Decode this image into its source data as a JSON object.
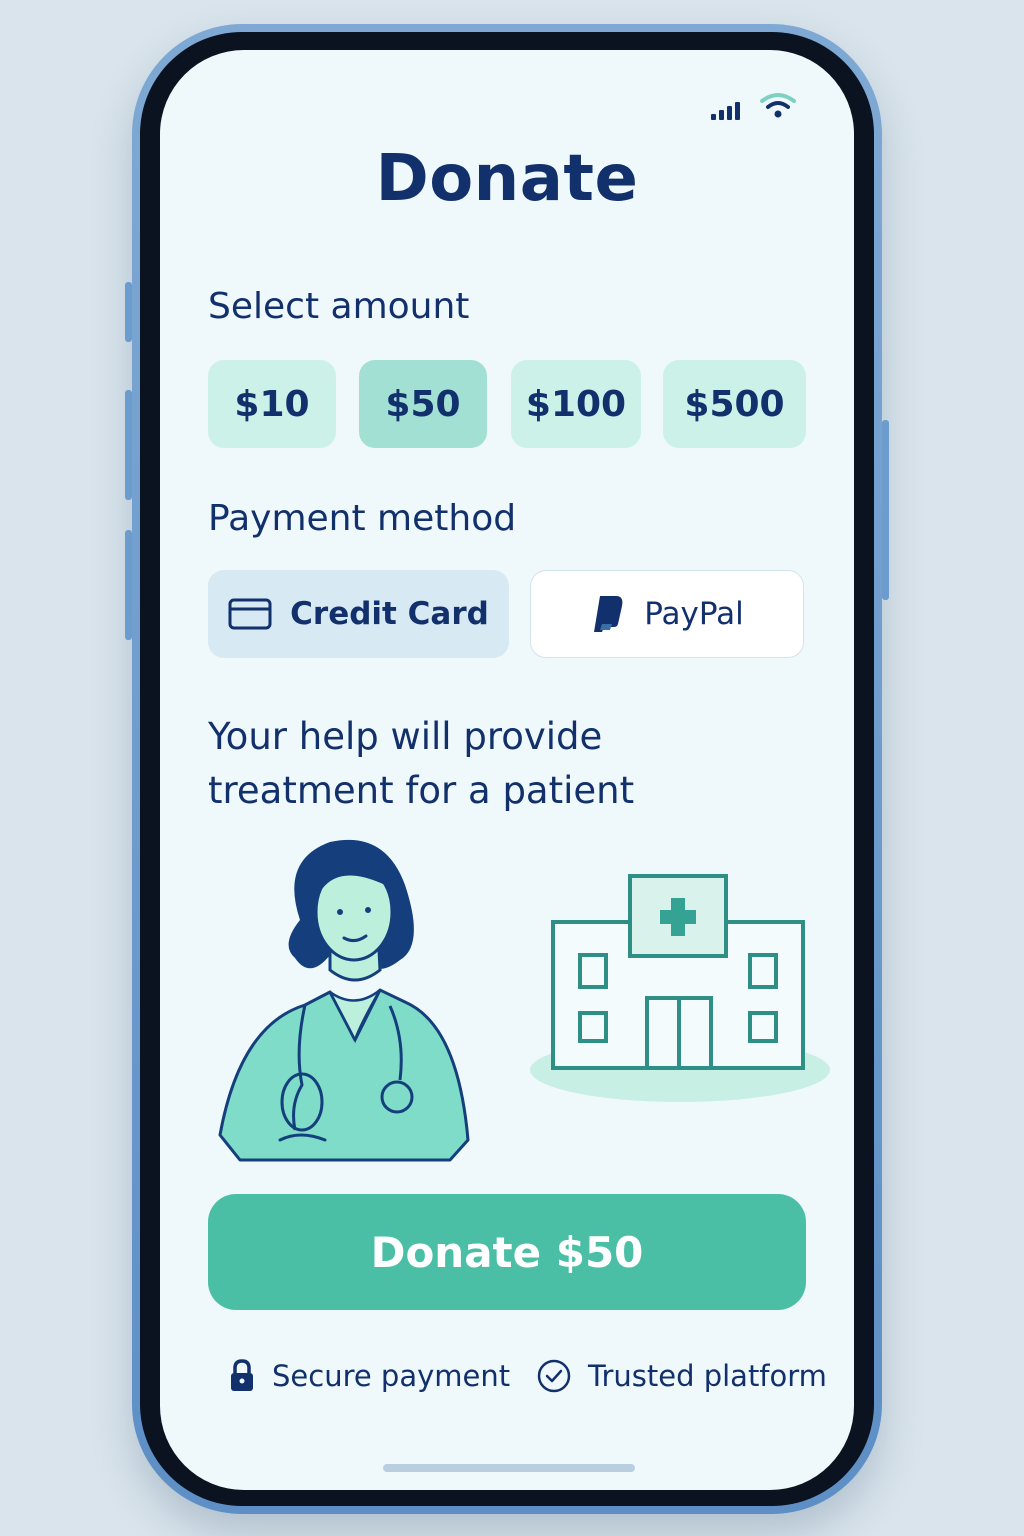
{
  "title": "Donate",
  "amount_section": {
    "label": "Select amount",
    "options": [
      {
        "label": "$10",
        "selected": false
      },
      {
        "label": "$50",
        "selected": true
      },
      {
        "label": "$100",
        "selected": false
      },
      {
        "label": "$500",
        "selected": false
      }
    ]
  },
  "payment_section": {
    "label": "Payment method",
    "methods": [
      {
        "label": "Credit Card",
        "icon": "credit-card-icon"
      },
      {
        "label": "PayPal",
        "icon": "paypal-icon"
      }
    ]
  },
  "message": "Your help will provide treatment for a patient",
  "donate_button": "Donate $50",
  "footer": {
    "secure": "Secure payment",
    "trusted": "Trusted platform"
  },
  "colors": {
    "primary": "#4bbfa5",
    "text": "#12306b",
    "chip": "#ccf1e9",
    "chip_selected": "#a3e0d4",
    "screen_bg": "#eff8fb"
  }
}
